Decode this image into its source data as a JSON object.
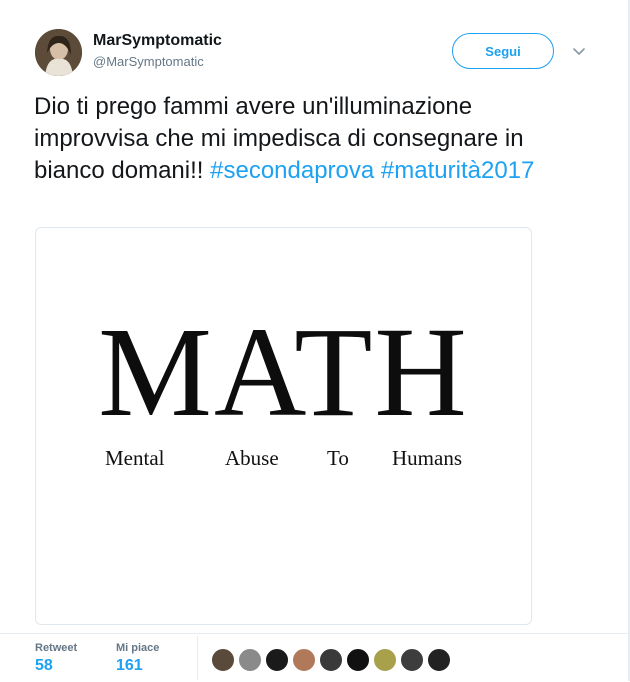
{
  "user": {
    "display_name": "MarSymptomatic",
    "screen_name": "@MarSymptomatic",
    "avatar_icon": "user-avatar"
  },
  "follow_button": {
    "label": "Segui"
  },
  "caret_icon": "chevron-down-icon",
  "tweet": {
    "text": "Dio ti prego fammi avere un'illuminazione improvvisa che mi impedisca di consegnare in bianco domani!!",
    "hashtags": [
      "#secondaprova",
      "#maturità2017"
    ]
  },
  "media": {
    "title": "MATH",
    "words": [
      "Mental",
      "Abuse",
      "To",
      "Humans"
    ]
  },
  "stats": {
    "retweet_label": "Retweet",
    "retweet_count": "58",
    "like_label": "Mi piace",
    "like_count": "161"
  },
  "likers": [
    {
      "name": "liker-avatar-1",
      "color": "#5a4a3a"
    },
    {
      "name": "liker-avatar-2",
      "color": "#8a8a8a"
    },
    {
      "name": "liker-avatar-3",
      "color": "#1a1a1a"
    },
    {
      "name": "liker-avatar-4",
      "color": "#b07a5a"
    },
    {
      "name": "liker-avatar-5",
      "color": "#3a3a3a"
    },
    {
      "name": "liker-avatar-6",
      "color": "#111111"
    },
    {
      "name": "liker-avatar-7",
      "color": "#a8a04a"
    },
    {
      "name": "liker-avatar-8",
      "color": "#3d3d3d"
    },
    {
      "name": "liker-avatar-9",
      "color": "#222222"
    }
  ],
  "colors": {
    "accent": "#1da1f2",
    "text": "#14171a",
    "muted": "#657786",
    "border": "#e6ecf0"
  }
}
